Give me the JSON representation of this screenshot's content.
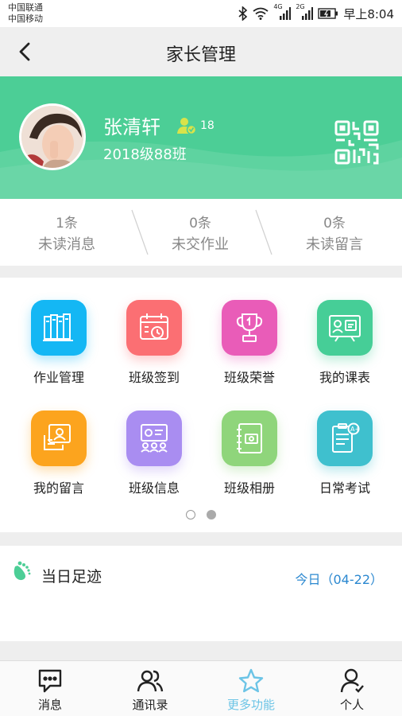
{
  "status_bar": {
    "carrier1": "中国联通",
    "carrier2": "中国移动",
    "signal1_label": "4G",
    "signal2_label": "2G",
    "time": "早上8:04"
  },
  "nav": {
    "title": "家长管理",
    "back_icon": "chevron-left-icon"
  },
  "profile": {
    "name": "张清轩",
    "badge_count": "18",
    "class_name": "2018级88班",
    "bg_color": "#4cce96"
  },
  "stats": [
    {
      "count": "1条",
      "label": "未读消息"
    },
    {
      "count": "0条",
      "label": "未交作业"
    },
    {
      "count": "0条",
      "label": "未读留言"
    }
  ],
  "grid": [
    {
      "label": "作业管理",
      "icon": "books-icon",
      "color": "#14b7f4"
    },
    {
      "label": "班级签到",
      "icon": "calendar-clock-icon",
      "color": "#fb6f73"
    },
    {
      "label": "班级荣誉",
      "icon": "trophy-icon",
      "color": "#e95cb8"
    },
    {
      "label": "我的课表",
      "icon": "schedule-board-icon",
      "color": "#46ce97"
    },
    {
      "label": "我的留言",
      "icon": "message-board-icon",
      "color": "#fca41e"
    },
    {
      "label": "班级信息",
      "icon": "class-info-icon",
      "color": "#a98df1"
    },
    {
      "label": "班级相册",
      "icon": "photo-album-icon",
      "color": "#8fd57b"
    },
    {
      "label": "日常考试",
      "icon": "exam-paper-icon",
      "color": "#3fc0ce"
    }
  ],
  "pager": {
    "pages": 2,
    "current": 2
  },
  "footprint": {
    "title": "当日足迹",
    "date": "今日（04-22）",
    "icon": "footprint-icon"
  },
  "tabbar": [
    {
      "label": "消息",
      "icon": "chat-icon",
      "active": false
    },
    {
      "label": "通讯录",
      "icon": "contacts-icon",
      "active": false
    },
    {
      "label": "更多功能",
      "icon": "star-icon",
      "active": true
    },
    {
      "label": "个人",
      "icon": "person-icon",
      "active": false
    }
  ],
  "colors": {
    "accent_blue": "#2b88d0",
    "tab_active": "#6cc4e6"
  }
}
